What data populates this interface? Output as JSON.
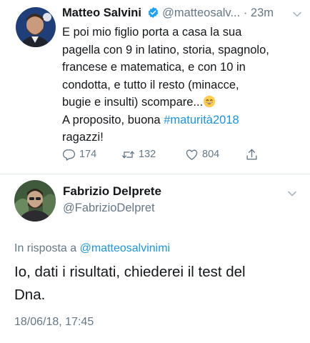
{
  "tweet": {
    "name": "Matteo Salvini",
    "handle": "@matteosalv...",
    "separator": "·",
    "time": "23m",
    "lines": [
      "E poi mio figlio porta a casa la sua",
      "pagella con 9 in latino, storia, spagnolo,",
      "francese e matematica, e con 10 in",
      "condotta, e tutto il resto (minacce,",
      "bugie e insulti) scompare..."
    ],
    "line6_prefix": "A proposito, buona ",
    "hashtag": "#maturità2018",
    "line7": "ragazzi!",
    "counts": {
      "replies": "174",
      "retweets": "132",
      "likes": "804"
    },
    "icons": {
      "verified": "verified-badge-icon",
      "emoji": "grinning-emoji-icon",
      "reply": "reply-icon",
      "retweet": "retweet-icon",
      "like": "heart-icon",
      "share": "share-icon",
      "menu": "chevron-down-icon"
    }
  },
  "reply": {
    "name": "Fabrizio Delprete",
    "handle": "@FabrizioDelpret",
    "in_reply_prefix": "In risposta a ",
    "in_reply_mention": "@matteosalvinimi",
    "text_lines": [
      "Io, dati i risultati, chiederei il test del",
      "Dna."
    ],
    "date": "18/06/18, 17:45"
  },
  "colors": {
    "link": "#1b95e0",
    "secondary_text": "#657786",
    "primary_text": "#14171a",
    "divider": "#e1e8ed",
    "verified": "#1da1f2"
  }
}
